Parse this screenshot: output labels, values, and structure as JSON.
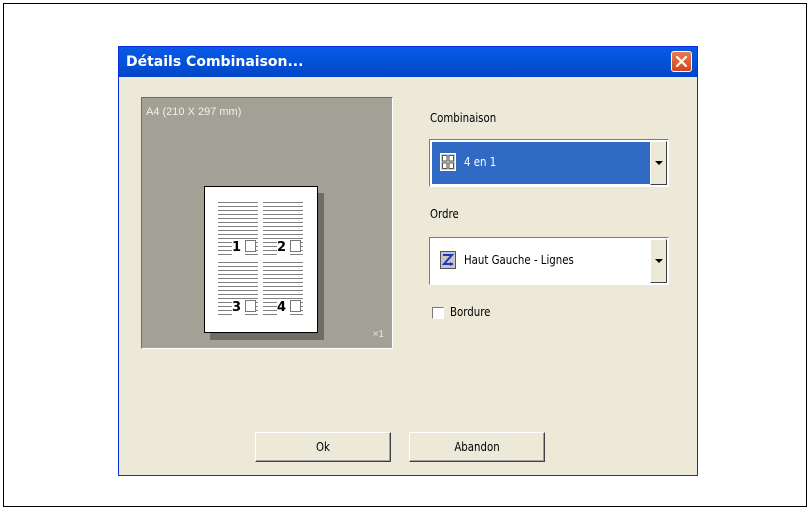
{
  "dialog": {
    "title": "Détails Combinaison...",
    "close_icon": "close-icon"
  },
  "preview": {
    "paper_size": "A4  (210 X 297 mm)",
    "copies": "×1",
    "pages": [
      "1",
      "2",
      "3",
      "4"
    ]
  },
  "combination": {
    "label": "Combinaison",
    "value": "4 en 1",
    "icon": "grid-4up-icon"
  },
  "order": {
    "label": "Ordre",
    "value": "Haut Gauche - Lignes",
    "icon": "z-order-icon"
  },
  "border_checkbox": {
    "label": "Bordure",
    "checked": false
  },
  "buttons": {
    "ok": "Ok",
    "cancel": "Abandon"
  }
}
